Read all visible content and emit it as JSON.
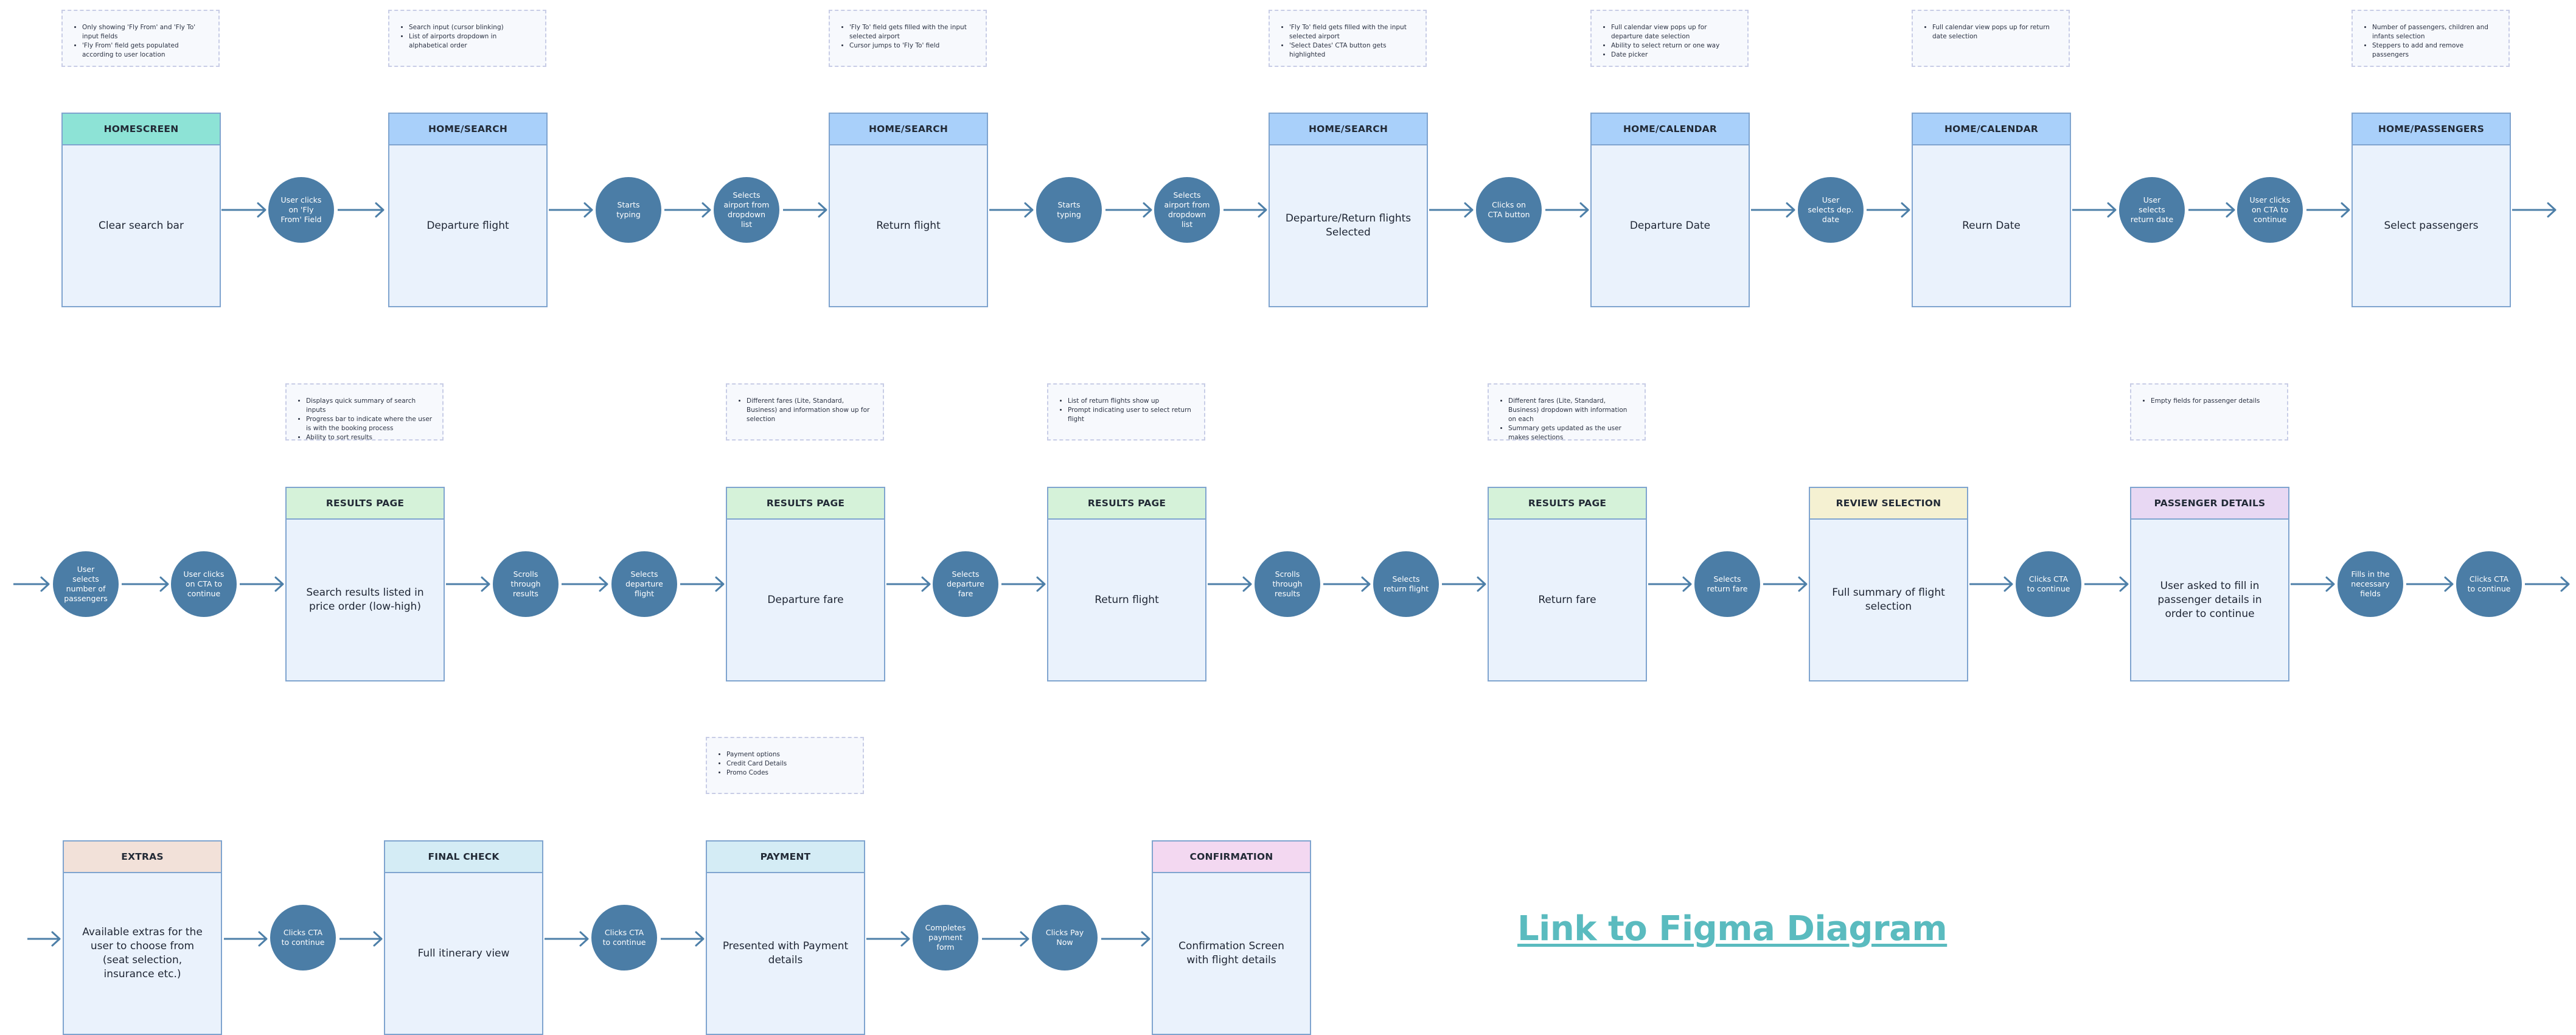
{
  "screens": [
    {
      "id": "s1",
      "header": "HOMESCREEN",
      "body": "Clear search bar",
      "header_color": "#8de3d6"
    },
    {
      "id": "s2",
      "header": "HOME/SEARCH",
      "body": "Departure flight",
      "header_color": "#a9d0fa"
    },
    {
      "id": "s3",
      "header": "HOME/SEARCH",
      "body": "Return flight",
      "header_color": "#a9d0fa"
    },
    {
      "id": "s4",
      "header": "HOME/SEARCH",
      "body": "Departure/Return flights Selected",
      "header_color": "#a9d0fa"
    },
    {
      "id": "s5",
      "header": "HOME/CALENDAR",
      "body": "Departure Date",
      "header_color": "#a9d0fa"
    },
    {
      "id": "s6",
      "header": "HOME/CALENDAR",
      "body": "Reurn Date",
      "header_color": "#a9d0fa"
    },
    {
      "id": "s7",
      "header": "HOME/PASSENGERS",
      "body": "Select passengers",
      "header_color": "#a9d0fa"
    },
    {
      "id": "s8",
      "header": "RESULTS PAGE",
      "body": "Search results listed in price order (low-high)",
      "header_color": "#d5f2d9"
    },
    {
      "id": "s9",
      "header": "RESULTS PAGE",
      "body": "Departure fare",
      "header_color": "#d5f2d9"
    },
    {
      "id": "s10",
      "header": "RESULTS PAGE",
      "body": "Return flight",
      "header_color": "#d5f2d9"
    },
    {
      "id": "s11",
      "header": "RESULTS PAGE",
      "body": "Return fare",
      "header_color": "#d5f2d9"
    },
    {
      "id": "s12",
      "header": "REVIEW SELECTION",
      "body": "Full summary of flight selection",
      "header_color": "#f5f1d2"
    },
    {
      "id": "s13",
      "header": "PASSENGER DETAILS",
      "body": "User asked to fill in passenger details in order to continue",
      "header_color": "#e8d8f3"
    },
    {
      "id": "s14",
      "header": "EXTRAS",
      "body": "Available extras for the user to choose from (seat selection, insurance etc.)",
      "header_color": "#f2e1d9"
    },
    {
      "id": "s15",
      "header": "FINAL CHECK",
      "body": "Full itinerary view",
      "header_color": "#d4ecf5"
    },
    {
      "id": "s16",
      "header": "PAYMENT",
      "body": "Presented with Payment details",
      "header_color": "#d4ecf5"
    },
    {
      "id": "s17",
      "header": "CONFIRMATION",
      "body": "Confirmation Screen with flight details",
      "header_color": "#f3d8f1"
    }
  ],
  "actions": [
    {
      "id": "a1",
      "text": "User clicks on 'Fly From' Field"
    },
    {
      "id": "a2",
      "text": "Starts typing"
    },
    {
      "id": "a3",
      "text": "Selects airport from dropdown list"
    },
    {
      "id": "a4",
      "text": "Starts typing"
    },
    {
      "id": "a5",
      "text": "Selects airport from dropdown list"
    },
    {
      "id": "a6",
      "text": "Clicks on CTA button"
    },
    {
      "id": "a7",
      "text": "User selects dep. date"
    },
    {
      "id": "a8",
      "text": "User selects return date"
    },
    {
      "id": "a9",
      "text": "User clicks on CTA to continue"
    },
    {
      "id": "a10",
      "text": "User selects number of passengers"
    },
    {
      "id": "a11",
      "text": "User clicks on CTA to continue"
    },
    {
      "id": "a12",
      "text": "Scrolls through results"
    },
    {
      "id": "a13",
      "text": "Selects departure flight"
    },
    {
      "id": "a14",
      "text": "Selects departure fare"
    },
    {
      "id": "a15",
      "text": "Scrolls through results"
    },
    {
      "id": "a16",
      "text": "Selects return flight"
    },
    {
      "id": "a17",
      "text": "Selects return fare"
    },
    {
      "id": "a18",
      "text": "Clicks CTA to continue"
    },
    {
      "id": "a19",
      "text": "Fills in the necessary fields"
    },
    {
      "id": "a20",
      "text": "Clicks CTA to continue"
    },
    {
      "id": "a21",
      "text": "Clicks CTA to continue"
    },
    {
      "id": "a22",
      "text": "Clicks CTA to continue"
    },
    {
      "id": "a23",
      "text": "Completes payment form"
    },
    {
      "id": "a24",
      "text": "Clicks Pay Now"
    }
  ],
  "notes": [
    {
      "id": "n1",
      "items": [
        "Only showing 'Fly From' and 'Fly To' input fields",
        "'Fly From' field gets populated according to user location"
      ]
    },
    {
      "id": "n2",
      "items": [
        "Search input (cursor blinking)",
        "List of airports dropdown in alphabetical order"
      ]
    },
    {
      "id": "n3",
      "items": [
        "'Fly To' field gets filled with the input selected airport",
        "Cursor jumps to 'Fly To' field"
      ]
    },
    {
      "id": "n4",
      "items": [
        "'Fly To' field gets filled with the input selected airport",
        "'Select Dates' CTA button gets highlighted"
      ]
    },
    {
      "id": "n5",
      "items": [
        "Full calendar view pops up for departure date selection",
        "Ability to select return or one way",
        "Date picker"
      ]
    },
    {
      "id": "n6",
      "items": [
        "Full calendar view pops up for return date selection"
      ]
    },
    {
      "id": "n7",
      "items": [
        "Number of passengers, children and infants selection",
        "Steppers to add and remove passengers"
      ]
    },
    {
      "id": "n8",
      "items": [
        "Displays quick summary of search inputs",
        "Progress bar to indicate where the user is with the booking process",
        "Ability to sort results"
      ]
    },
    {
      "id": "n9",
      "items": [
        "Different fares (Lite, Standard, Business) and information show up for selection"
      ]
    },
    {
      "id": "n10",
      "items": [
        "List of return flights show up",
        "Prompt indicating user to select return flight"
      ]
    },
    {
      "id": "n11",
      "items": [
        "Different fares (Lite, Standard, Business) dropdown with information on each",
        "Summary gets updated as the user makes selections"
      ]
    },
    {
      "id": "n12",
      "items": [
        "Empty fields for passenger details"
      ]
    },
    {
      "id": "n13",
      "items": [
        "Payment options",
        "Credit Card Details",
        "Promo Codes"
      ]
    }
  ],
  "link": {
    "text": "Link to Figma Diagram"
  },
  "colors": {
    "screen_border": "#7fa4cf",
    "screen_fill": "#eaf2fc",
    "action_fill": "#4b7da6",
    "connector": "#4d7fa8",
    "note_border": "#c8cde6",
    "link": "#5abbbf"
  }
}
